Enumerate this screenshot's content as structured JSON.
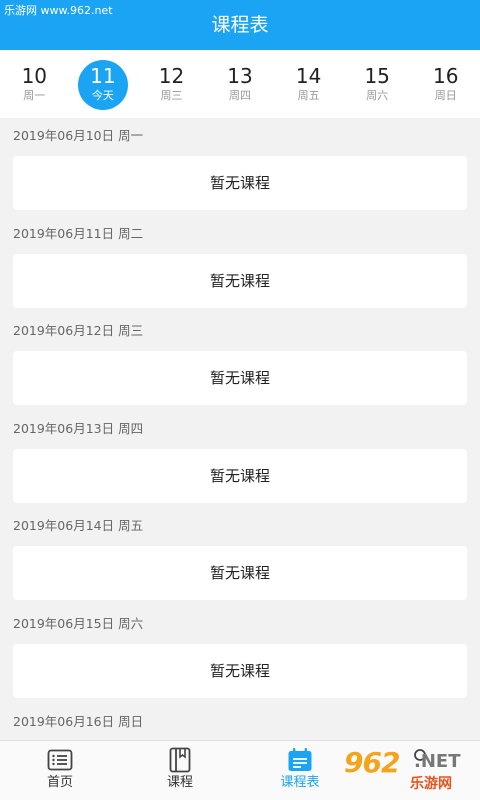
{
  "header": {
    "watermark": "乐游网 www.962.net",
    "title": "课程表"
  },
  "week": [
    {
      "num": "10",
      "label": "周一"
    },
    {
      "num": "11",
      "label": "今天"
    },
    {
      "num": "12",
      "label": "周三"
    },
    {
      "num": "13",
      "label": "周四"
    },
    {
      "num": "14",
      "label": "周五"
    },
    {
      "num": "15",
      "label": "周六"
    },
    {
      "num": "16",
      "label": "周日"
    }
  ],
  "selected_day": "11",
  "days": [
    {
      "date": "2019年06月10日 周一",
      "content": "暂无课程"
    },
    {
      "date": "2019年06月11日 周二",
      "content": "暂无课程"
    },
    {
      "date": "2019年06月12日 周三",
      "content": "暂无课程"
    },
    {
      "date": "2019年06月13日 周四",
      "content": "暂无课程"
    },
    {
      "date": "2019年06月14日 周五",
      "content": "暂无课程"
    },
    {
      "date": "2019年06月15日 周六",
      "content": "暂无课程"
    },
    {
      "date": "2019年06月16日 周日",
      "content": ""
    }
  ],
  "tabs": [
    {
      "label": "首页",
      "icon": "home-list-icon"
    },
    {
      "label": "课程",
      "icon": "book-icon"
    },
    {
      "label": "课程表",
      "icon": "calendar-icon"
    },
    {
      "label": "",
      "icon": "profile-icon"
    }
  ],
  "active_tab": "课程表",
  "colors": {
    "accent": "#1ba4f4",
    "background": "#f2f2f2"
  },
  "watermark_logo": {
    "num": "962",
    "net": ".NET",
    "cn": "乐游网"
  }
}
